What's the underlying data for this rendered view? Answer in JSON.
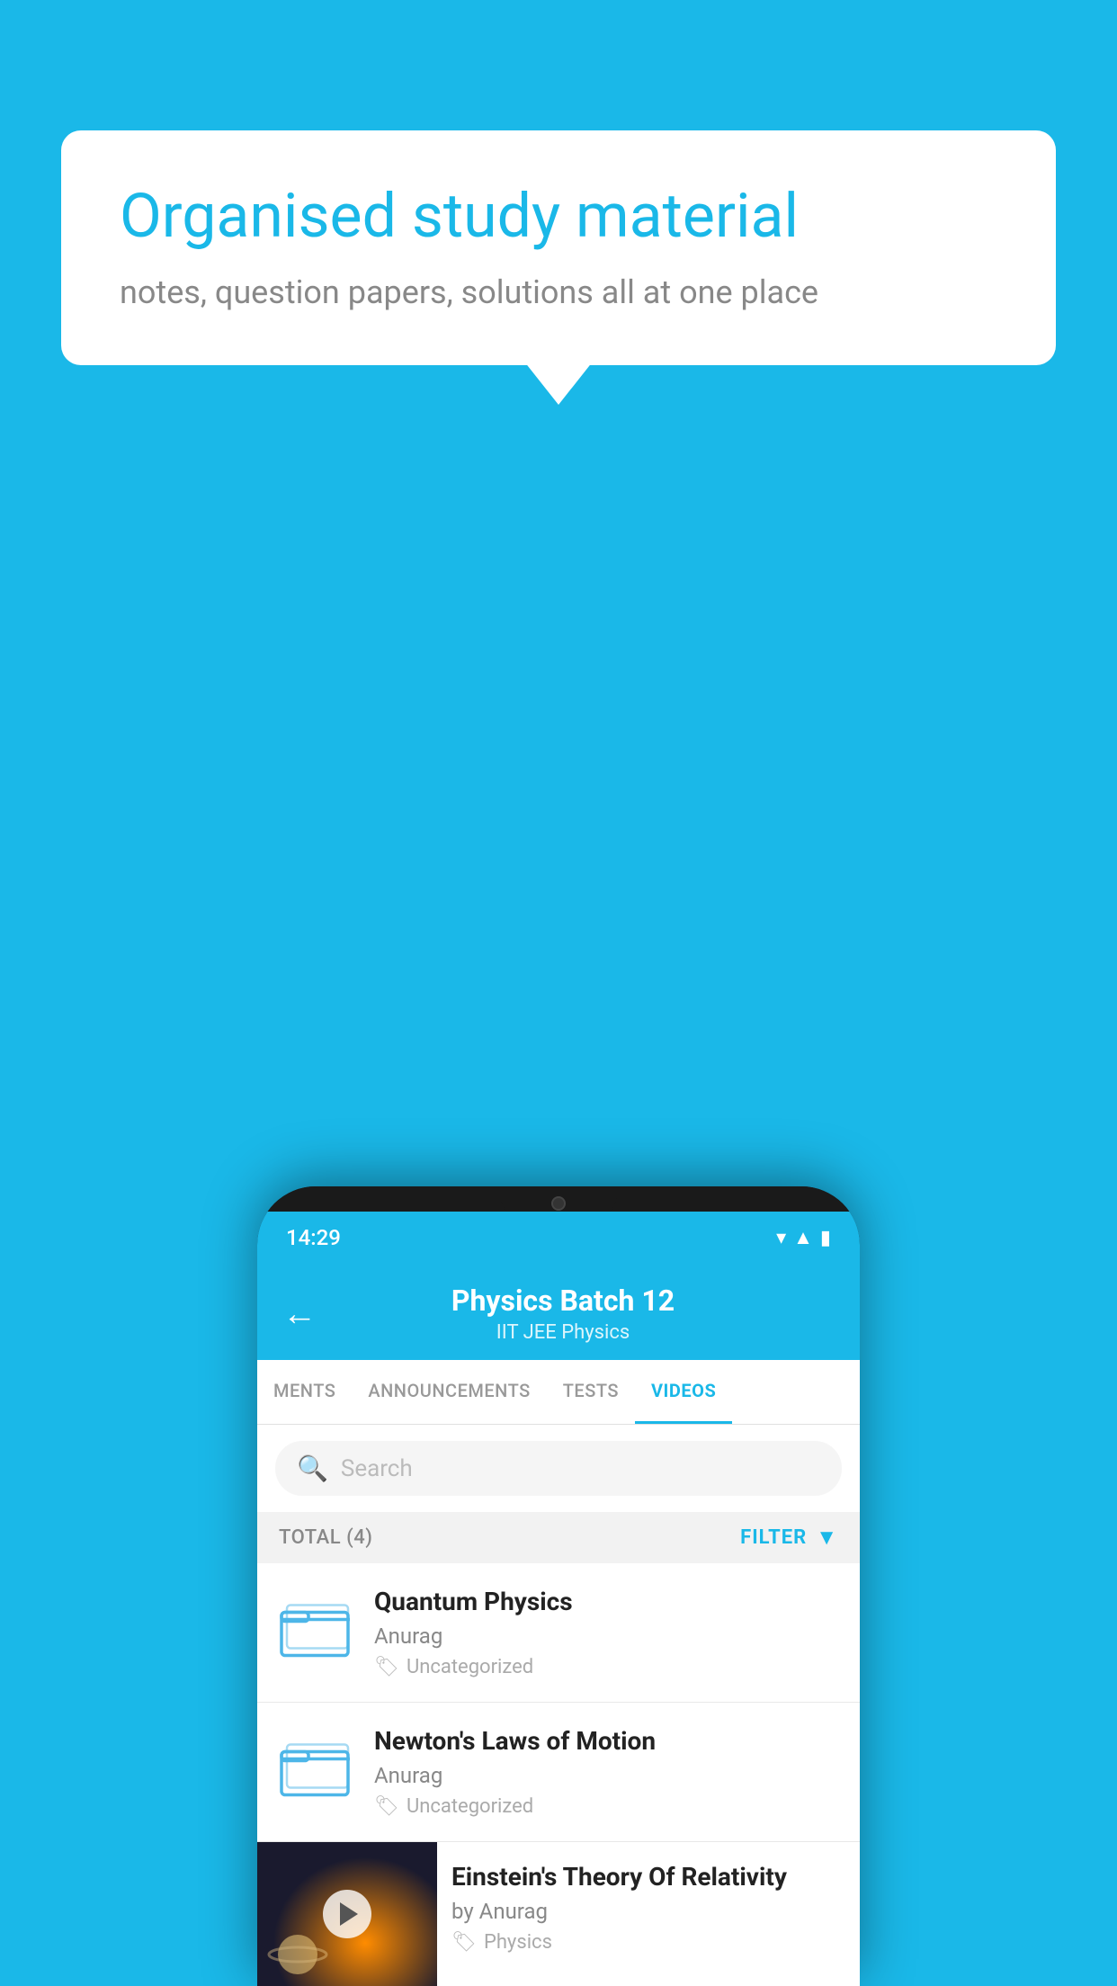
{
  "background_color": "#1ab8e8",
  "speech_bubble": {
    "title": "Organised study material",
    "subtitle": "notes, question papers, solutions all at one place"
  },
  "status_bar": {
    "time": "14:29",
    "icons": [
      "wifi",
      "signal",
      "battery"
    ]
  },
  "app_header": {
    "back_label": "←",
    "title": "Physics Batch 12",
    "subtitle": "IIT JEE   Physics"
  },
  "tabs": [
    {
      "label": "MENTS",
      "active": false
    },
    {
      "label": "ANNOUNCEMENTS",
      "active": false
    },
    {
      "label": "TESTS",
      "active": false
    },
    {
      "label": "VIDEOS",
      "active": true
    }
  ],
  "search": {
    "placeholder": "Search"
  },
  "filter_row": {
    "total_label": "TOTAL (4)",
    "filter_label": "FILTER"
  },
  "videos": [
    {
      "title": "Quantum Physics",
      "author": "Anurag",
      "tag": "Uncategorized",
      "type": "folder"
    },
    {
      "title": "Newton's Laws of Motion",
      "author": "Anurag",
      "tag": "Uncategorized",
      "type": "folder"
    },
    {
      "title": "Einstein's Theory Of Relativity",
      "author": "by Anurag",
      "tag": "Physics",
      "type": "video"
    }
  ]
}
